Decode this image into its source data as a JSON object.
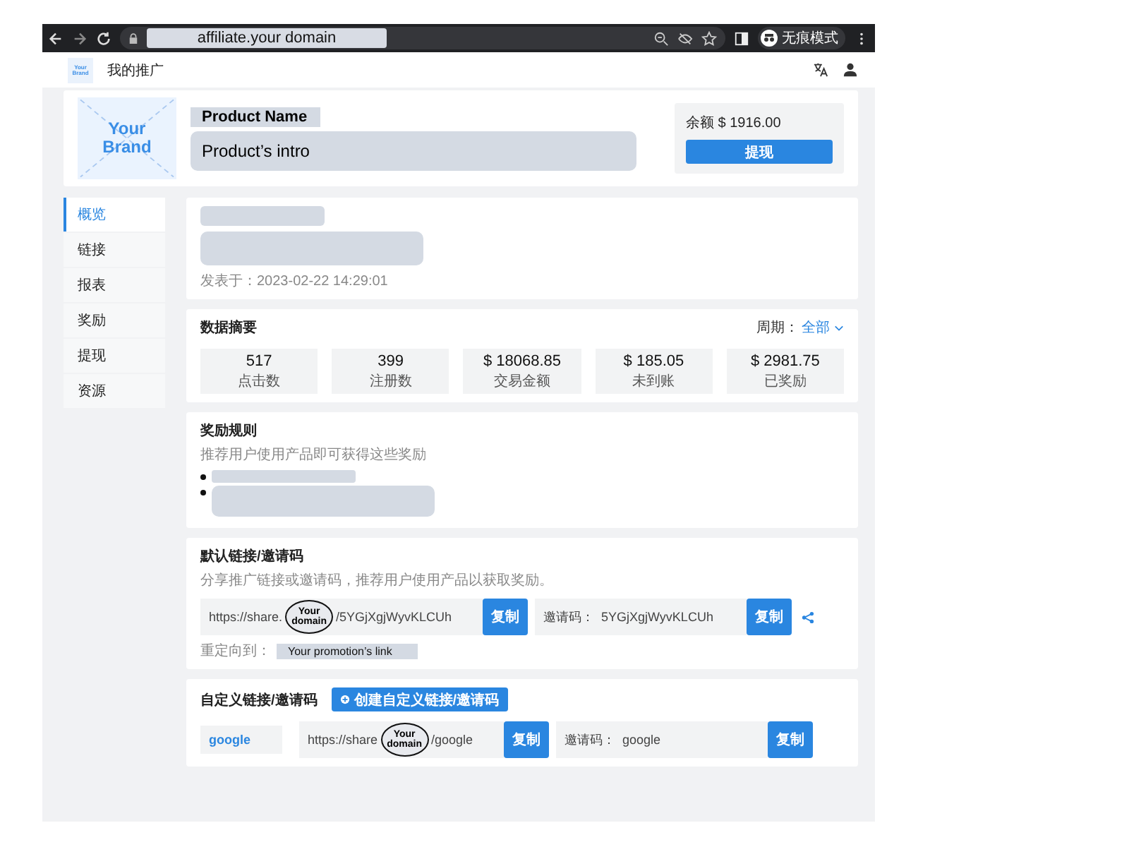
{
  "browser": {
    "url": "affiliate.your domain",
    "profile": "无痕模式"
  },
  "header": {
    "logo_top": "Your",
    "logo_bottom": "Brand",
    "title": "我的推广"
  },
  "product": {
    "logo_top": "Your",
    "logo_bottom": "Brand",
    "name": "Product Name",
    "intro": "Product’s intro",
    "balance": "余额 $ 1916.00",
    "withdraw": "提现"
  },
  "sidebar": {
    "items": [
      {
        "label": "概览",
        "selected": true
      },
      {
        "label": "链接",
        "selected": false
      },
      {
        "label": "报表",
        "selected": false
      },
      {
        "label": "奖励",
        "selected": false
      },
      {
        "label": "提现",
        "selected": false
      },
      {
        "label": "资源",
        "selected": false
      }
    ]
  },
  "announcement": {
    "published": "发表于：2023-02-22 14:29:01"
  },
  "summary": {
    "title": "数据摘要",
    "period_label": "周期：",
    "period": "全部",
    "stats": [
      {
        "value": "517",
        "label": "点击数"
      },
      {
        "value": "399",
        "label": "注册数"
      },
      {
        "value": "$ 18068.85",
        "label": "交易金额"
      },
      {
        "value": "$ 185.05",
        "label": "未到账"
      },
      {
        "value": "$ 2981.75",
        "label": "已奖励"
      }
    ]
  },
  "rules": {
    "title": "奖励规则",
    "subtitle": "推荐用户使用产品即可获得这些奖励"
  },
  "default_link": {
    "title": "默认链接/邀请码",
    "subtitle": "分享推广链接或邀请码，推荐用户使用产品以获取奖励。",
    "url_start": "https://share.",
    "callout": "Your domain",
    "url_end": "/5YGjXgjWyvKLCUh",
    "copy": "复制",
    "code_label": "邀请码：",
    "code": "5YGjXgjWyvKLCUh",
    "copy2": "复制",
    "redirect_label": "重定向到：",
    "redirect": "Your promotion’s link"
  },
  "custom_link": {
    "title": "自定义链接/邀请码",
    "create": "创建自定义链接/邀请码",
    "name": "google",
    "url_start": "https://share",
    "callout": "Your domain",
    "url_end": "/google",
    "copy": "复制",
    "code_label": "邀请码：",
    "code": "google",
    "copy2": "复制"
  }
}
